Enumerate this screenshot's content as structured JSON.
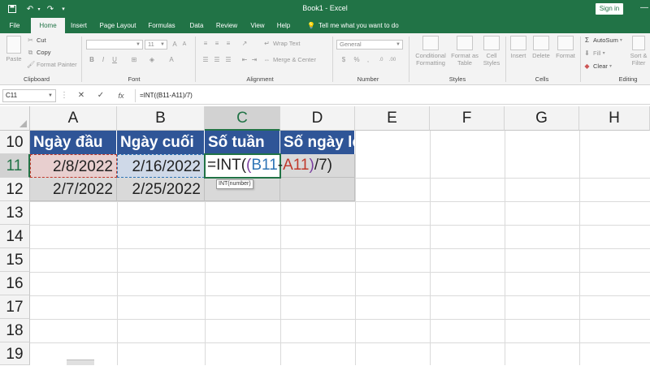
{
  "titlebar": {
    "title": "Book1 - Excel",
    "signin": "Sign in",
    "icons": [
      "save-icon",
      "undo-icon",
      "redo-icon",
      "customize-icon"
    ]
  },
  "tabs": [
    "File",
    "Home",
    "Insert",
    "Page Layout",
    "Formulas",
    "Data",
    "Review",
    "View",
    "Help"
  ],
  "active_tab": "Home",
  "tell_me": "Tell me what you want to do",
  "ribbon": {
    "clipboard": {
      "paste": "Paste",
      "cut": "Cut",
      "copy": "Copy",
      "format_painter": "Format Painter",
      "label": "Clipboard"
    },
    "font": {
      "name": "",
      "size": "11",
      "label": "Font",
      "bold": "B",
      "italic": "I",
      "underline": "U"
    },
    "alignment": {
      "wrap": "Wrap Text",
      "merge": "Merge & Center",
      "label": "Alignment"
    },
    "number": {
      "format": "General",
      "currency": "$",
      "percent": "%",
      "comma": ",",
      "label": "Number"
    },
    "styles": {
      "conditional": "Conditional\nFormatting",
      "format_table": "Format as\nTable",
      "cell_styles": "Cell\nStyles",
      "label": "Styles"
    },
    "cells": {
      "insert": "Insert",
      "delete": "Delete",
      "format": "Format",
      "label": "Cells"
    },
    "editing": {
      "autosum": "AutoSum",
      "fill": "Fill",
      "clear": "Clear",
      "sort_filter": "Sort &\nFilter",
      "label": "Editing"
    }
  },
  "formula_bar": {
    "name_box": "C11",
    "formula": "=INT((B11-A11)/7)"
  },
  "columns": [
    "A",
    "B",
    "C",
    "D",
    "E",
    "F",
    "G",
    "H"
  ],
  "selected_column": "C",
  "rows": [
    "10",
    "11",
    "12",
    "13",
    "14",
    "15",
    "16",
    "17",
    "18",
    "19"
  ],
  "selected_row": "11",
  "table": {
    "headers": [
      "Ngày đầu",
      "Ngày cuối",
      "Số tuần",
      "Số ngày lẻ"
    ],
    "row11": [
      "2/8/2022",
      "2/16/2022"
    ],
    "row12": [
      "2/7/2022",
      "2/25/2022"
    ]
  },
  "active_cell": {
    "prefix": "=INT(",
    "open_paren": "(",
    "ref1": "B11",
    "minus": "-",
    "ref2": "A11",
    "close_paren": ")",
    "suffix": "/7)",
    "tooltip": "INT(number)"
  },
  "colors": {
    "excel_green": "#217346",
    "header_blue": "#2f5597",
    "ref_blue": "#2e75b6",
    "ref_red": "#c0392b"
  }
}
